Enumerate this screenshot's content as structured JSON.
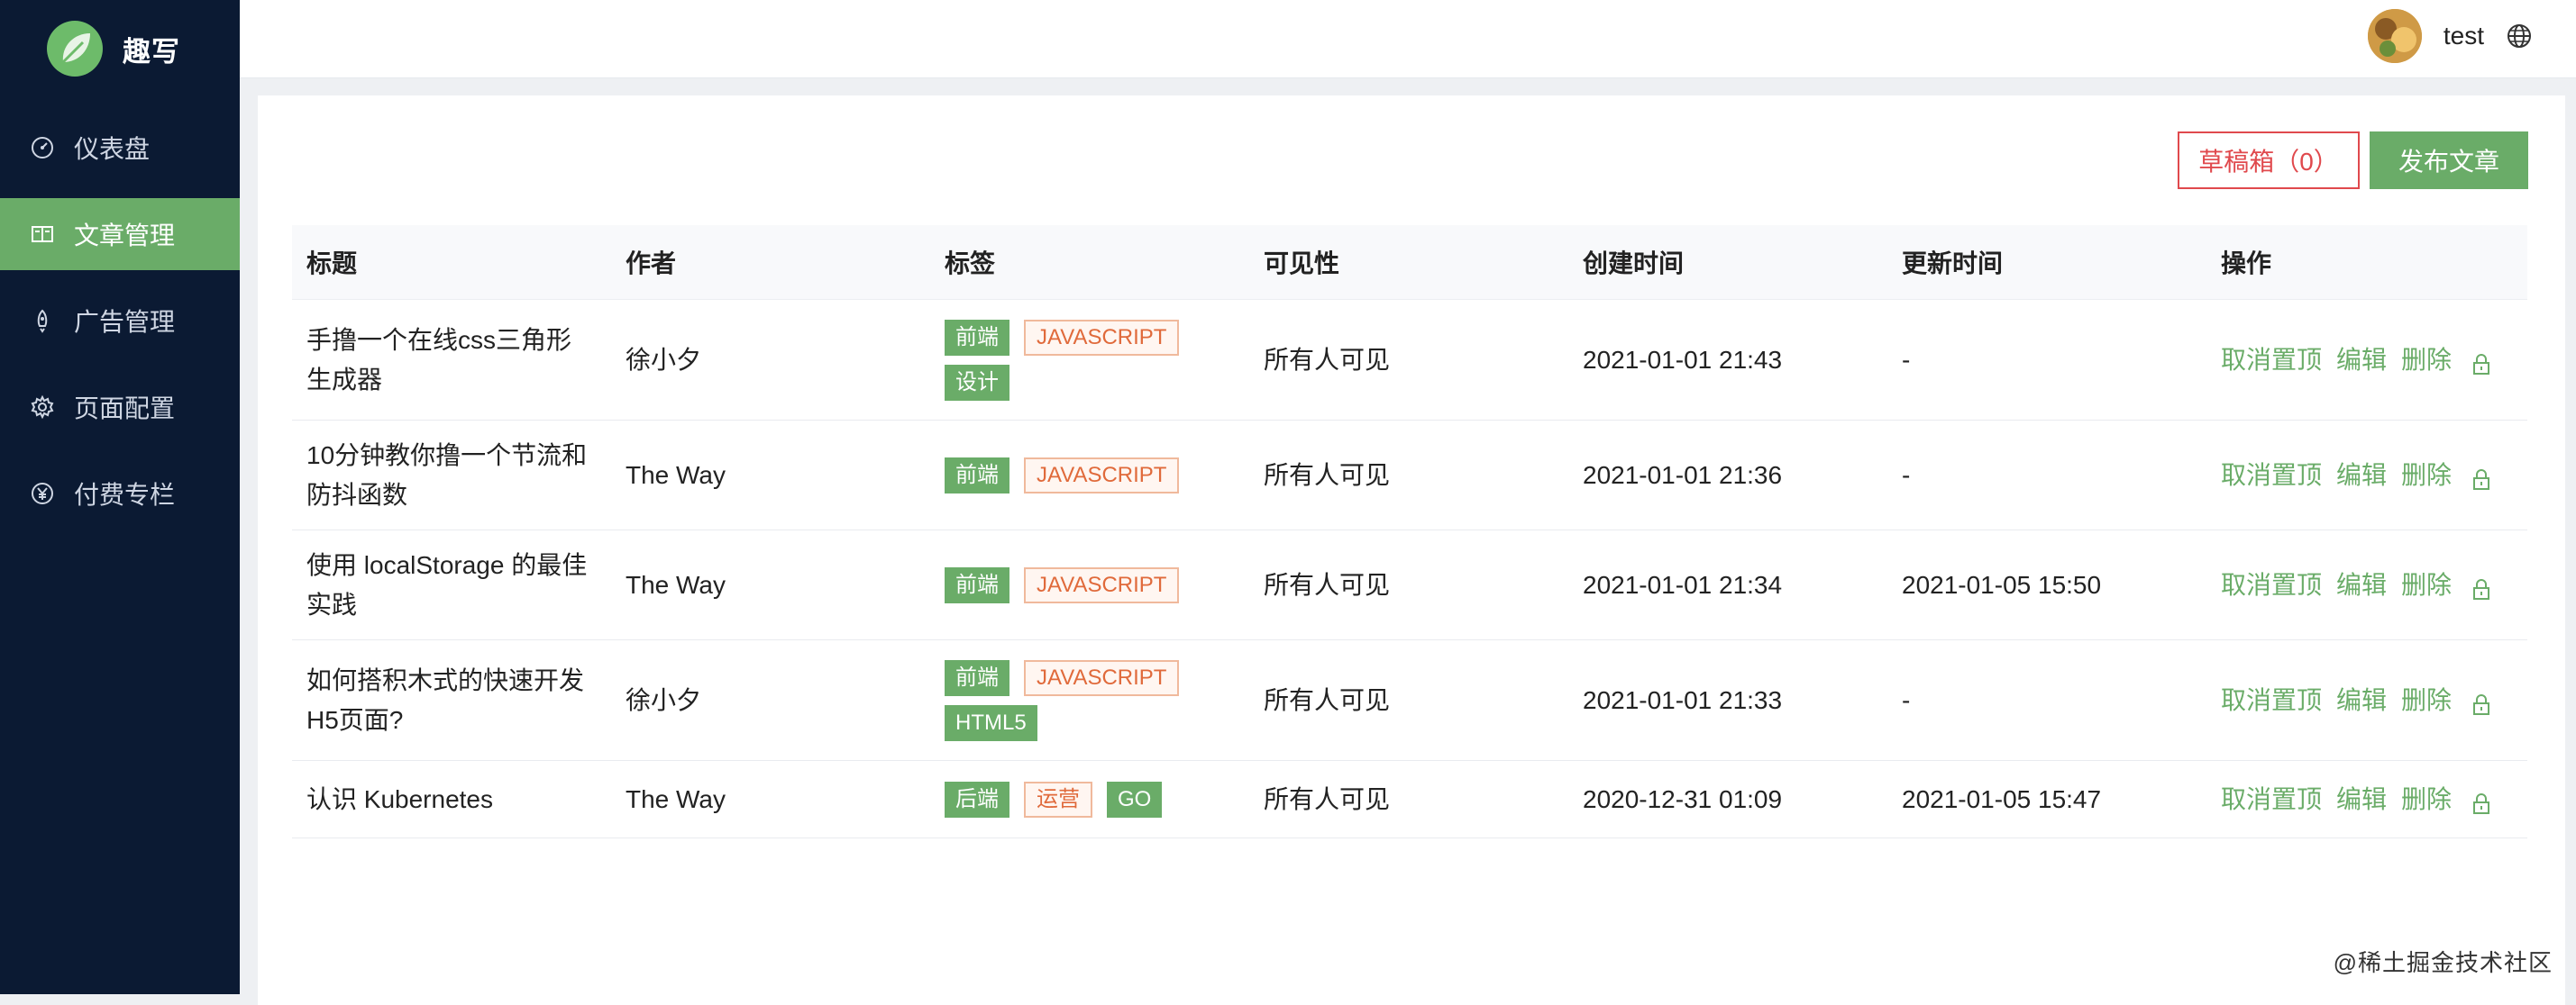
{
  "app": {
    "name": "趣写"
  },
  "sidebar": {
    "items": [
      {
        "label": "仪表盘",
        "icon": "dashboard-icon",
        "active": false
      },
      {
        "label": "文章管理",
        "icon": "book-icon",
        "active": true
      },
      {
        "label": "广告管理",
        "icon": "rocket-icon",
        "active": false
      },
      {
        "label": "页面配置",
        "icon": "gear-icon",
        "active": false
      },
      {
        "label": "付费专栏",
        "icon": "yen-icon",
        "active": false
      }
    ]
  },
  "header": {
    "username": "test",
    "language_icon": "globe-icon"
  },
  "toolbar": {
    "drafts_label": "草稿箱（0）",
    "publish_label": "发布文章"
  },
  "table": {
    "columns": [
      "标题",
      "作者",
      "标签",
      "可见性",
      "创建时间",
      "更新时间",
      "操作"
    ],
    "rows": [
      {
        "title": "手撸一个在线css三角形生成器",
        "author": "徐小夕",
        "tags": [
          {
            "label": "前端",
            "style": "green"
          },
          {
            "label": "JAVASCRIPT",
            "style": "outline"
          },
          {
            "label": "设计",
            "style": "green"
          }
        ],
        "visibility": "所有人可见",
        "created": "2021-01-01 21:43",
        "updated": "-"
      },
      {
        "title": "10分钟教你撸一个节流和防抖函数",
        "author": "The Way",
        "tags": [
          {
            "label": "前端",
            "style": "green"
          },
          {
            "label": "JAVASCRIPT",
            "style": "outline"
          }
        ],
        "visibility": "所有人可见",
        "created": "2021-01-01 21:36",
        "updated": "-"
      },
      {
        "title": "使用 localStorage 的最佳实践",
        "author": "The Way",
        "tags": [
          {
            "label": "前端",
            "style": "green"
          },
          {
            "label": "JAVASCRIPT",
            "style": "outline"
          }
        ],
        "visibility": "所有人可见",
        "created": "2021-01-01 21:34",
        "updated": "2021-01-05 15:50"
      },
      {
        "title": "如何搭积木式的快速开发H5页面?",
        "author": "徐小夕",
        "tags": [
          {
            "label": "前端",
            "style": "green"
          },
          {
            "label": "JAVASCRIPT",
            "style": "outline"
          },
          {
            "label": "HTML5",
            "style": "green"
          }
        ],
        "visibility": "所有人可见",
        "created": "2021-01-01 21:33",
        "updated": "-"
      },
      {
        "title": "认识 Kubernetes",
        "author": "The Way",
        "tags": [
          {
            "label": "后端",
            "style": "green"
          },
          {
            "label": "运营",
            "style": "outline"
          },
          {
            "label": "GO",
            "style": "green"
          }
        ],
        "visibility": "所有人可见",
        "created": "2020-12-31 01:09",
        "updated": "2021-01-05 15:47"
      }
    ],
    "actions": {
      "unpin": "取消置顶",
      "edit": "编辑",
      "delete": "删除",
      "lock_icon": "lock-icon"
    }
  },
  "watermark": "@稀土掘金技术社区",
  "colors": {
    "sidebar_bg": "#0b1a33",
    "accent_green": "#6aac68",
    "danger_red": "#e0494d",
    "tag_orange": "#e06a3b"
  }
}
